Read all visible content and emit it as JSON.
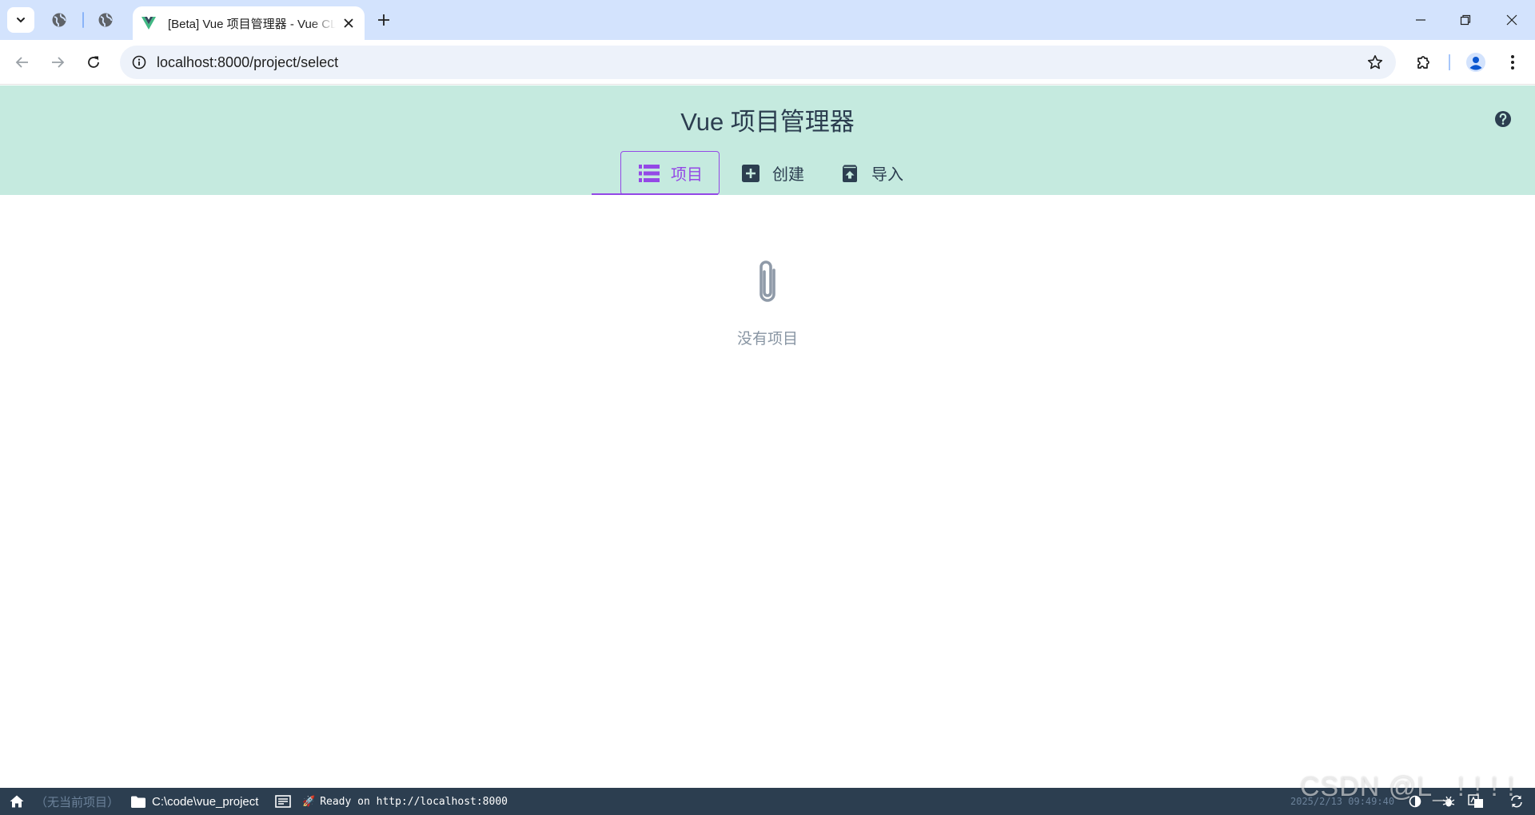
{
  "browser": {
    "tab_title": "[Beta] Vue 项目管理器 - Vue CLI",
    "url": "localhost:8000/project/select"
  },
  "header": {
    "title": "Vue 项目管理器",
    "tabs": [
      {
        "label": "项目",
        "icon": "list-icon",
        "active": true
      },
      {
        "label": "创建",
        "icon": "add-box-icon",
        "active": false
      },
      {
        "label": "导入",
        "icon": "unarchive-icon",
        "active": false
      }
    ]
  },
  "main": {
    "empty_message": "没有项目",
    "empty_icon": "attachment-icon"
  },
  "status_bar": {
    "project": "（无当前项目）",
    "path": "C:\\code\\vue_project",
    "log": "Ready on http://localhost:8000",
    "time": "2025/2/13 09:49:40"
  },
  "watermark": "CSDN @L_ ! ! ! !",
  "colors": {
    "header_bg": "#c5eadf",
    "accent": "#9448e6",
    "statusbar_bg": "#2c3e50",
    "text": "#2c3e50"
  }
}
